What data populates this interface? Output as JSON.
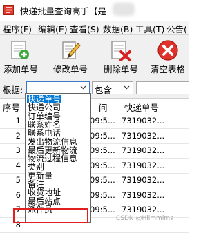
{
  "window": {
    "title": "快递批量查询高手【是"
  },
  "menu": {
    "items": [
      "程序(F)",
      "编辑(E)",
      "查看(S)",
      "数据(B)",
      "工具(T)",
      "公告("
    ]
  },
  "toolbar": {
    "add_label": "添加单号",
    "edit_label": "修改单号",
    "delete_label": "删除单号",
    "clear_label": "清空表格"
  },
  "filter": {
    "label": "根据:",
    "field_value": "",
    "operator_value": "包含",
    "search_value": ""
  },
  "grid": {
    "headers": [
      "序号",
      "间",
      "快递单号"
    ],
    "rows": [
      {
        "num": "1",
        "time": "09:5...",
        "code": "7319032..."
      },
      {
        "num": "2",
        "time": "09:5...",
        "code": "7319032..."
      },
      {
        "num": "3",
        "time": "09:5...",
        "code": "7319032..."
      },
      {
        "num": "4",
        "time": "09:5...",
        "code": "7319032..."
      },
      {
        "num": "5",
        "time": "09:5...",
        "code": "7319032..."
      },
      {
        "num": "6",
        "time": "09:5...",
        "code": "7319032..."
      },
      {
        "num": "7",
        "time": "09:5...",
        "code": "7319032..."
      },
      {
        "num": "8",
        "time": "",
        "code": ""
      }
    ]
  },
  "dropdown": {
    "options": [
      "快递单号",
      "快递公司",
      "订单编号",
      "联系姓名",
      "联系电话",
      "发出物流信息",
      "最后更新物流",
      "物流过程信息",
      "类别",
      "更新量",
      "备注",
      "收货地址",
      "最后站点",
      "派件员"
    ],
    "selected_index": 0
  },
  "watermark": "CSDN @Hiimmima",
  "colors": {
    "selection": "#0078d7",
    "highlight_border": "#e02020"
  }
}
